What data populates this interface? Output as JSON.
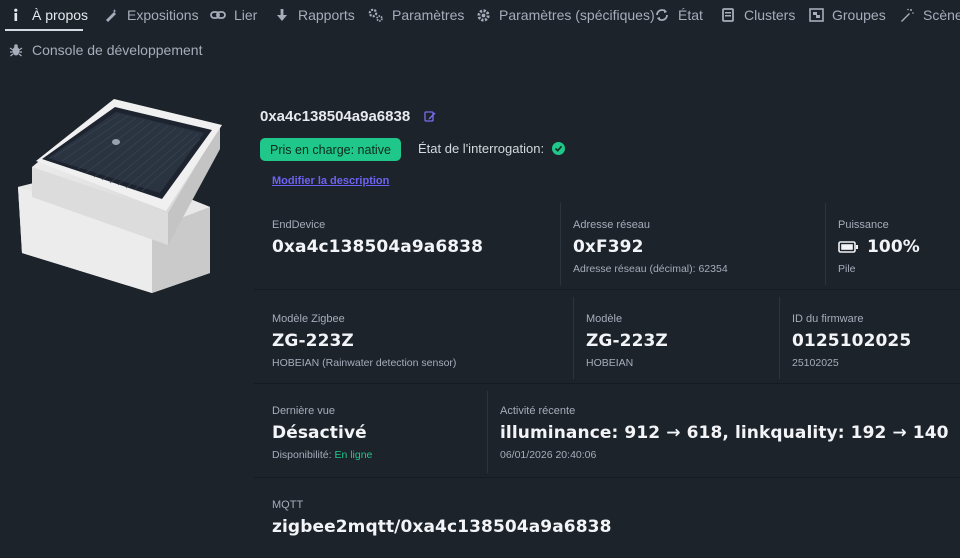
{
  "tabs": [
    {
      "label": "À propos",
      "icon": "info-icon",
      "active": true
    },
    {
      "label": "Expositions",
      "icon": "wand-icon"
    },
    {
      "label": "Lier",
      "icon": "link-icon"
    },
    {
      "label": "Rapports",
      "icon": "arrow-down-icon"
    },
    {
      "label": "Paramètres",
      "icon": "cogs-icon"
    },
    {
      "label": "Paramètres (spécifiques)",
      "icon": "gear-icon"
    },
    {
      "label": "État",
      "icon": "refresh-icon"
    },
    {
      "label": "Clusters",
      "icon": "list-icon"
    },
    {
      "label": "Groupes",
      "icon": "object-group-icon"
    },
    {
      "label": "Scène",
      "icon": "magic-icon"
    },
    {
      "label": "Console de développement",
      "icon": "bug-icon"
    }
  ],
  "device": {
    "title": "0xa4c138504a9a6838",
    "badge": "Pris en charge: native",
    "poll_label": "État de l'interrogation:",
    "modify_link": "Modifier la description"
  },
  "info": {
    "type_label": "EndDevice",
    "type_value": "0xa4c138504a9a6838",
    "network_label": "Adresse réseau",
    "network_value": "0xF392",
    "network_sub": "Adresse réseau (décimal): 62354",
    "power_label": "Puissance",
    "power_value": "100%",
    "power_sub": "Pile",
    "zigbee_model_label": "Modèle Zigbee",
    "zigbee_model_value": "ZG-223Z",
    "zigbee_model_sub": "HOBEIAN (Rainwater detection sensor)",
    "model_label": "Modèle",
    "model_value": "ZG-223Z",
    "model_sub": "HOBEIAN",
    "firmware_label": "ID du firmware",
    "firmware_value": "0125102025",
    "firmware_sub": "25102025",
    "last_seen_label": "Dernière vue",
    "last_seen_value": "Désactivé",
    "availability_label": "Disponibilité:",
    "availability_value": "En ligne",
    "activity_label": "Activité récente",
    "activity_value": "illuminance: 912 → 618, linkquality: 192 → 140",
    "activity_time": "06/01/2026 20:40:06",
    "mqtt_label": "MQTT",
    "mqtt_value": "zigbee2mqtt/0xa4c138504a9a6838"
  },
  "colors": {
    "background": "#1d232a",
    "accent_green": "#1fc88a",
    "link_purple": "#6d63f2"
  }
}
